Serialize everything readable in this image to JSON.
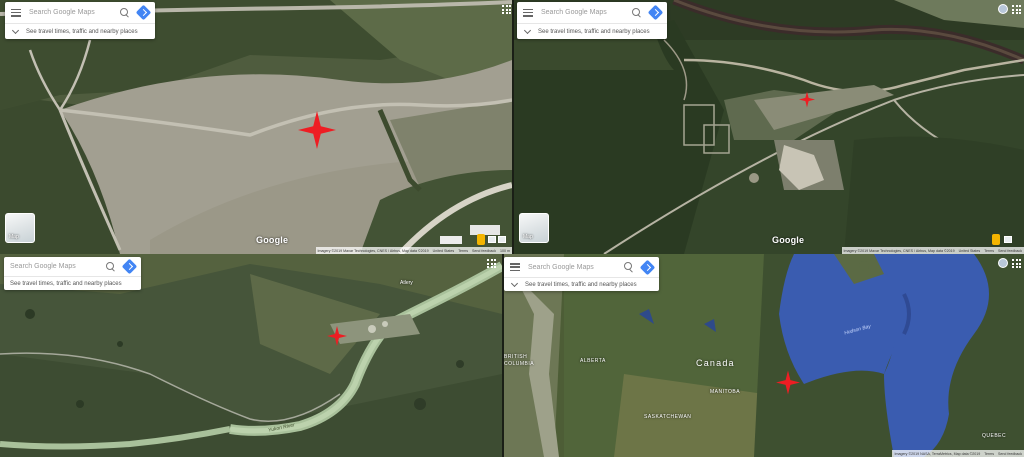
{
  "colors": {
    "marker": "#ee1d23",
    "search_accent": "#4285f4"
  },
  "panels": [
    {
      "search": {
        "placeholder": "Search Google Maps",
        "travel": "See travel times, traffic and nearby places"
      },
      "layer_label": "Map",
      "logo": "Google",
      "footer": [
        "Imagery ©2019 Maxar Technologies, CNES / Airbus, Map data ©2019",
        "United States",
        "Terms",
        "Send feedback",
        "100 m"
      ]
    },
    {
      "search": {
        "placeholder": "Search Google Maps",
        "travel": "See travel times, traffic and nearby places"
      },
      "layer_label": "Map",
      "logo": "Google",
      "footer": [
        "Imagery ©2019 Maxar Technologies, CNES / Airbus, Map data ©2019",
        "United States",
        "Terms",
        "Send feedback"
      ]
    },
    {
      "search": {
        "placeholder": "Search Google Maps",
        "travel": "See travel times, traffic and nearby places"
      },
      "labels": {
        "place": "Atlery",
        "river": "Yukon River"
      }
    },
    {
      "search": {
        "placeholder": "Search Google Maps",
        "travel": "See travel times, traffic and nearby places"
      },
      "labels": {
        "country": "Canada",
        "bay": "Hudson Bay",
        "bc": [
          "BRITISH",
          "COLUMBIA"
        ],
        "alberta": "ALBERTA",
        "sask": "SASKATCHEWAN",
        "manitoba": "MANITOBA",
        "quebec": "QUEBEC"
      },
      "footer": [
        "Imagery ©2019 NASA, TerraMetrics, Map data ©2019",
        "Terms",
        "Send feedback"
      ]
    }
  ]
}
